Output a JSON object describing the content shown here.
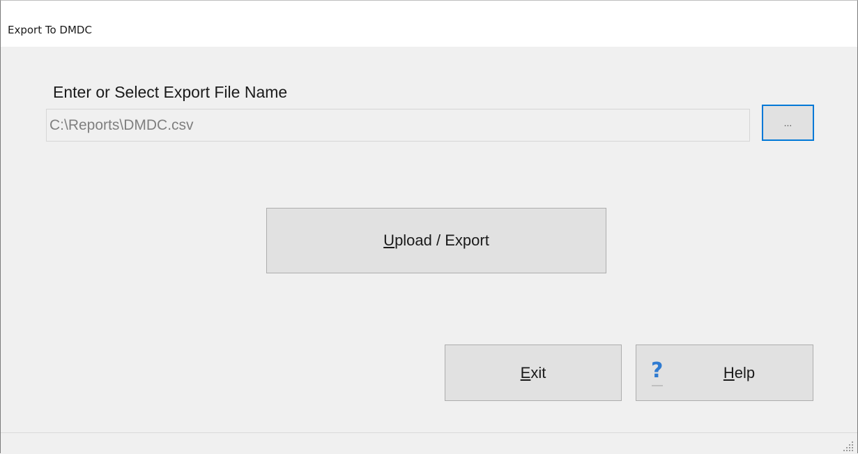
{
  "window": {
    "title": "Export To DMDC"
  },
  "file": {
    "label": "Enter or Select Export File Name",
    "value": "C:\\Reports\\DMDC.csv",
    "browse_label": "..."
  },
  "actions": {
    "upload_mnemonic": "U",
    "upload_rest": "pload / Export",
    "exit_mnemonic": "E",
    "exit_rest": "xit",
    "help_icon_glyph": "?",
    "help_mnemonic": "H",
    "help_rest": "elp"
  },
  "icons": {
    "help": "question-mark-icon",
    "grip": "resize-grip-icon"
  },
  "colors": {
    "accent": "#0078d7",
    "help_icon": "#2f7bd1",
    "button_face": "#e1e1e1",
    "dialog_bg": "#f0f0f0"
  }
}
